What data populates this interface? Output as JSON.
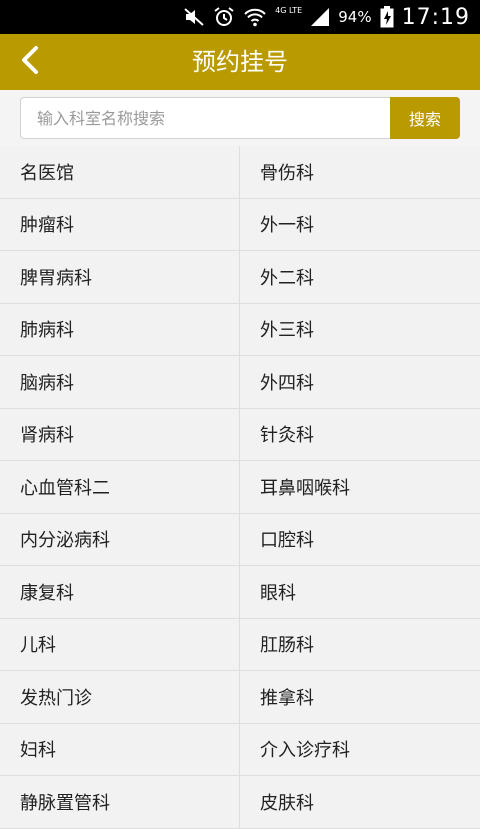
{
  "status_bar": {
    "network_label": "4G LTE",
    "battery_text": "94%",
    "time": "17:19",
    "icons": [
      "mute-icon",
      "alarm-icon",
      "wifi-icon",
      "signal-icon",
      "battery-charging-icon"
    ]
  },
  "header": {
    "title": "预约挂号",
    "back_icon": "chevron-left-icon",
    "color": "#b99a00"
  },
  "search": {
    "placeholder": "输入科室名称搜索",
    "value": "",
    "button_label": "搜索"
  },
  "departments": [
    [
      "名医馆",
      "骨伤科"
    ],
    [
      "肿瘤科",
      "外一科"
    ],
    [
      "脾胃病科",
      "外二科"
    ],
    [
      "肺病科",
      "外三科"
    ],
    [
      "脑病科",
      "外四科"
    ],
    [
      "肾病科",
      "针灸科"
    ],
    [
      "心血管科二",
      "耳鼻咽喉科"
    ],
    [
      "内分泌病科",
      "口腔科"
    ],
    [
      "康复科",
      "眼科"
    ],
    [
      "儿科",
      "肛肠科"
    ],
    [
      "发热门诊",
      "推拿科"
    ],
    [
      "妇科",
      "介入诊疗科"
    ],
    [
      "静脉置管科",
      "皮肤科"
    ]
  ]
}
